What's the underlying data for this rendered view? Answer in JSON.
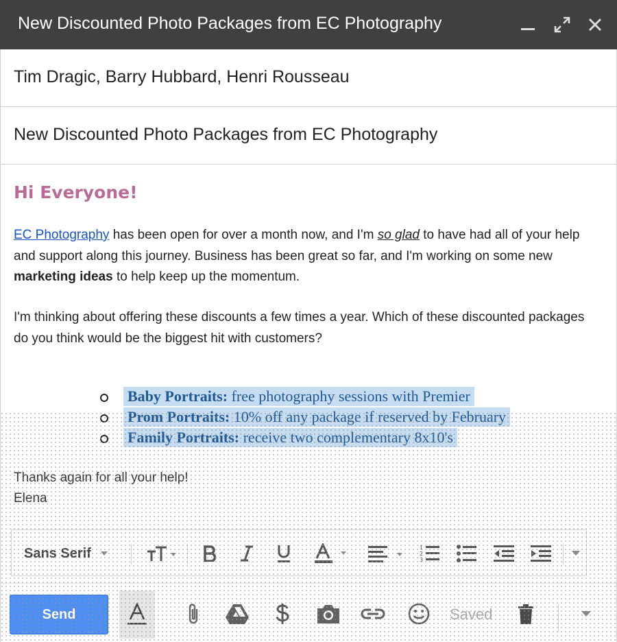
{
  "window": {
    "title": "New Discounted Photo Packages from EC Photography"
  },
  "compose": {
    "recipients": "Tim Dragic, Barry Hubbard, Henri Rousseau",
    "subject": "New Discounted Photo Packages from EC Photography",
    "greeting": "Hi Everyone!",
    "para1": {
      "link": "EC Photography",
      "t1": " has been open for over a month now, and I'm ",
      "emph": "so glad",
      "t2": " to have had all of your help and support along this journey. Business has been great so far, and I'm working on some new ",
      "bold": "marketing ideas",
      "t3": " to help keep up the momentum."
    },
    "para2": "I'm thinking about offering these discounts a few times a year. Which of these discounted packages do you think would be the biggest hit with customers?",
    "packages": [
      {
        "name": "Baby Portraits:",
        "desc": " free photography sessions with Premier"
      },
      {
        "name": "Prom Portraits:",
        "desc": " 10% off any package if reserved by February"
      },
      {
        "name": "Family Portraits:",
        "desc": " receive two complementary 8x10's"
      }
    ],
    "sign_off": "Thanks again for all your help!",
    "signature": "Elena"
  },
  "format_toolbar": {
    "font_family": "Sans Serif",
    "icons": [
      "text-size-icon",
      "bold-icon",
      "italic-icon",
      "underline-icon",
      "text-color-icon",
      "align-icon",
      "numbered-list-icon",
      "bulleted-list-icon",
      "indent-less-icon",
      "indent-more-icon",
      "more-formatting-icon"
    ]
  },
  "bottom_bar": {
    "send_label": "Send",
    "status": "Saved",
    "icons": [
      "formatting-toggle-icon",
      "attach-icon",
      "drive-icon",
      "money-icon",
      "photo-icon",
      "link-icon",
      "emoji-icon",
      "trash-icon",
      "more-options-icon"
    ]
  },
  "colors": {
    "title_bar": "#404040",
    "greeting": "#b96b98",
    "link": "#1a55b8",
    "highlight": "#c6dcf1",
    "package_text": "#1f5892",
    "send_button": "#4d8ef4"
  }
}
